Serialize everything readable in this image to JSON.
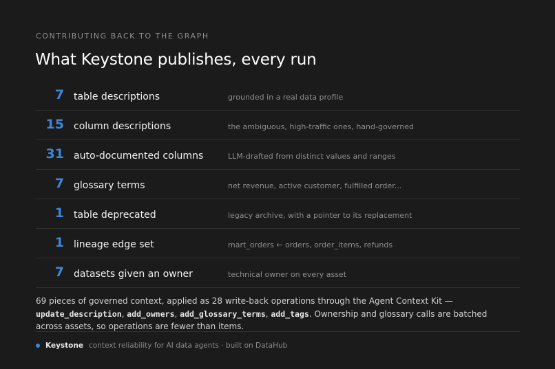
{
  "eyebrow": "CONTRIBUTING BACK TO THE GRAPH",
  "title": "What Keystone publishes, every run",
  "colors": {
    "accent": "#3f86d8",
    "background": "#1b1b1b"
  },
  "rows": [
    {
      "count": "7",
      "label": "table descriptions",
      "desc": "grounded in a real data profile"
    },
    {
      "count": "15",
      "label": "column descriptions",
      "desc": "the ambiguous, high-traffic ones, hand-governed"
    },
    {
      "count": "31",
      "label": "auto-documented columns",
      "desc": "LLM-drafted from distinct values and ranges"
    },
    {
      "count": "7",
      "label": "glossary terms",
      "desc": "net revenue, active customer, fulfilled order..."
    },
    {
      "count": "1",
      "label": "table deprecated",
      "desc": "legacy archive, with a pointer to its replacement"
    },
    {
      "count": "1",
      "label": "lineage edge set",
      "desc": "mart_orders ← orders, order_items, refunds"
    },
    {
      "count": "7",
      "label": "datasets given an owner",
      "desc": "technical owner on every asset"
    }
  ],
  "summary": {
    "text1": "69 pieces of governed context, applied as 28 write-back operations through the Agent Context Kit — ",
    "code1": "update_description",
    "sep1": ", ",
    "code2": "add_owners",
    "sep2": ", ",
    "code3": "add_glossary_terms",
    "sep3": ", ",
    "code4": "add_tags",
    "text2": ". Ownership and glossary calls are batched across assets, so operations are fewer than items."
  },
  "footer": {
    "icon": "status-dot-icon",
    "brand": "Keystone",
    "tagline": "context reliability for AI data agents · built on DataHub"
  }
}
